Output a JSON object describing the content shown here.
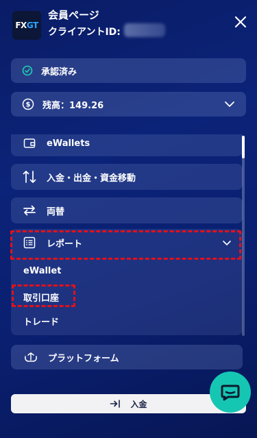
{
  "header": {
    "logo_fx": "FX",
    "logo_gt": "GT",
    "title": "会員ページ",
    "client_label": "クライアントID:"
  },
  "status": {
    "label": "承認済み"
  },
  "balance": {
    "label": "残高：149.26"
  },
  "menu": {
    "ewallets": "eWallets",
    "transfer": "入金・出金・資金移動",
    "exchange": "両替",
    "report": "レポート",
    "report_sub": [
      "eWallet",
      "取引口座",
      "トレード"
    ],
    "platform": "プラットフォーム"
  },
  "footer": {
    "deposit_label": "入金"
  },
  "colors": {
    "accent": "#15c6b3",
    "highlight_dash": "#e3101a",
    "approved_icon": "#1fd1b0"
  },
  "icons": {
    "close": "close-icon",
    "approved": "check-circle-icon",
    "balance": "dollar-circle-icon",
    "ewallets": "wallet-icon",
    "transfer": "arrows-up-down-icon",
    "exchange": "swap-icon",
    "report": "report-list-icon",
    "platform": "platform-icon",
    "deposit": "login-arrow-icon",
    "chat": "chat-icon"
  }
}
